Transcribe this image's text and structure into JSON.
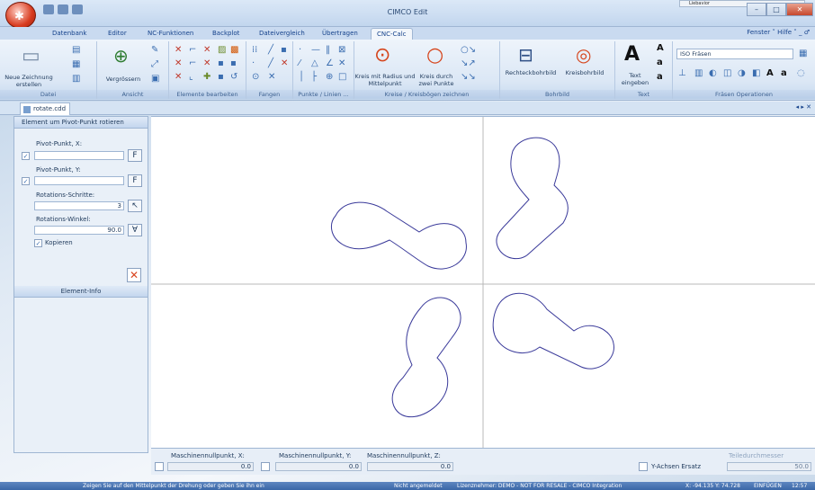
{
  "window": {
    "title": "CIMCO Edit",
    "mini_dialog": "Liebavior"
  },
  "tabs": [
    "Datenbank",
    "Editor",
    "NC-Funktionen",
    "Backplot",
    "Dateivergleich",
    "Übertragen",
    "CNC-Calc"
  ],
  "right_menu": "Fenster ˅  Hilfe ˅  _  ♂",
  "ribbon": {
    "groups": {
      "datei": "Datei",
      "ansicht": "Ansicht",
      "elemente": "Elemente bearbeiten",
      "fangen": "Fangen",
      "punkte": "Punkte / Linien ...",
      "kreise": "Kreise / Kreisbögen zeichnen",
      "bohrbild": "Bohrbild",
      "text": "Text",
      "fraesen": "Fräsen Operationen"
    },
    "neue_zeichnung": "Neue Zeichnung erstellen",
    "vergroessern": "Vergrössern",
    "kreis_radius": "Kreis mit Radius und Mittelpunkt",
    "kreis_punkte": "Kreis durch zwei Punkte",
    "rechteck": "Rechteckbohrbild",
    "kreisbohr": "Kreisbohrbild",
    "text_eingeben": "Text eingeben",
    "iso_combo": "ISO Fräsen"
  },
  "document_tab": "rotate.cdd",
  "panel": {
    "title": "Element um Pivot-Punkt rotieren",
    "pivot_x_label": "Pivot-Punkt, X:",
    "pivot_x_value": "",
    "pivot_y_label": "Pivot-Punkt, Y:",
    "pivot_y_value": "",
    "steps_label": "Rotations-Schritte:",
    "steps_value": "3",
    "angle_label": "Rotations-Winkel:",
    "angle_value": "90.0",
    "copy_label": "Kopieren",
    "info_title": "Element-Info"
  },
  "bottom": {
    "mx_label": "Maschinennullpunkt, X:",
    "mx_value": "0.0",
    "my_label": "Maschinennullpunkt, Y:",
    "my_value": "0.0",
    "mz_label": "Maschinennullpunkt, Z:",
    "mz_value": "0.0",
    "yaxis_label": "Y-Achsen Ersatz",
    "tool_label": "Teiledurchmesser",
    "tool_value": "50.0"
  },
  "status": {
    "hint": "Zeigen Sie auf den Mittelpunkt der Drehung oder geben Sie ihn ein",
    "login": "Nicht angemeldet",
    "license": "Lizenznehmer: DEMO - NOT FOR RESALE - CIMCO Integration",
    "coords": "X: -94.135  Y: 74.728",
    "mode": "EINFÜGEN",
    "time": "12:57"
  },
  "colors": {
    "accent": "#15428b",
    "shape": "#3a3a9a"
  }
}
